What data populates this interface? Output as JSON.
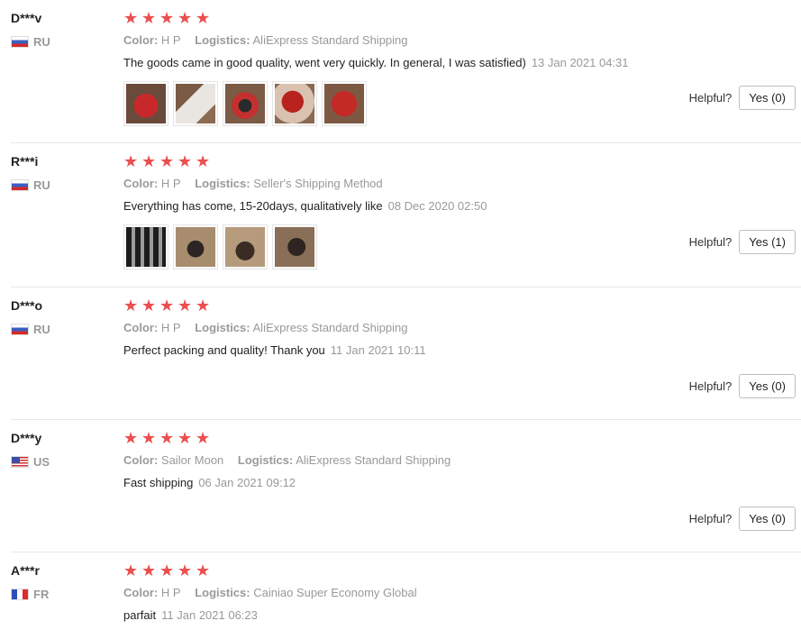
{
  "reviews": [
    {
      "user": "D***v",
      "country": "RU",
      "rating": 5,
      "color_label": "Color:",
      "color": "H P",
      "logistics_label": "Logistics:",
      "logistics": "AliExpress Standard Shipping",
      "text": "The goods came in good quality, went very quickly. In general, I was satisfied)",
      "date": "13 Jan 2021 04:31",
      "helpful_label": "Helpful?",
      "yes_label": "Yes (0)",
      "photos": 5
    },
    {
      "user": "R***i",
      "country": "RU",
      "rating": 5,
      "color_label": "Color:",
      "color": "H P",
      "logistics_label": "Logistics:",
      "logistics": "Seller's Shipping Method",
      "text": "Everything has come, 15-20days, qualitatively like",
      "date": "08 Dec 2020 02:50",
      "helpful_label": "Helpful?",
      "yes_label": "Yes (1)",
      "photos": 4
    },
    {
      "user": "D***o",
      "country": "RU",
      "rating": 5,
      "color_label": "Color:",
      "color": "H P",
      "logistics_label": "Logistics:",
      "logistics": "AliExpress Standard Shipping",
      "text": "Perfect packing and quality! Thank you",
      "date": "11 Jan 2021 10:11",
      "helpful_label": "Helpful?",
      "yes_label": "Yes (0)",
      "photos": 0
    },
    {
      "user": "D***y",
      "country": "US",
      "rating": 5,
      "color_label": "Color:",
      "color": "Sailor Moon",
      "logistics_label": "Logistics:",
      "logistics": "AliExpress Standard Shipping",
      "text": "Fast shipping",
      "date": "06 Jan 2021 09:12",
      "helpful_label": "Helpful?",
      "yes_label": "Yes (0)",
      "photos": 0
    },
    {
      "user": "A***r",
      "country": "FR",
      "rating": 5,
      "color_label": "Color:",
      "color": "H P",
      "logistics_label": "Logistics:",
      "logistics": "Cainiao Super Economy Global",
      "text": "parfait",
      "date": "11 Jan 2021 06:23",
      "photos": 0
    }
  ],
  "colors": {
    "star": "#ea4f4f",
    "muted": "#999999",
    "border": "#e8e8e8"
  },
  "icons": {
    "star": "star-icon",
    "flag_ru": "flag-ru-icon",
    "flag_us": "flag-us-icon",
    "flag_fr": "flag-fr-icon"
  }
}
